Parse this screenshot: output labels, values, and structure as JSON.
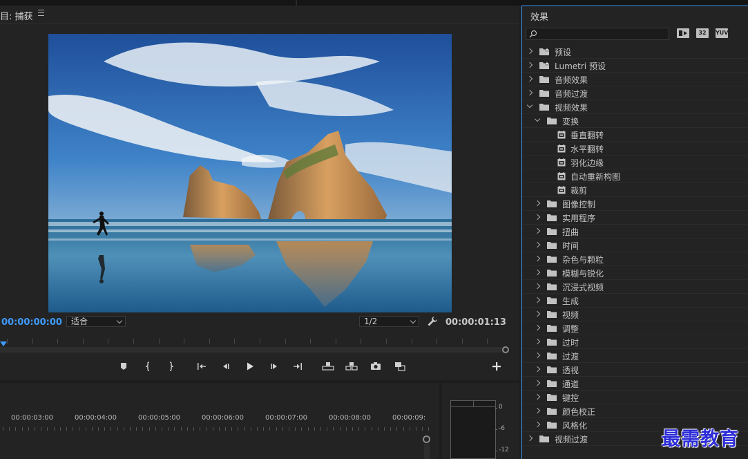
{
  "program_monitor": {
    "title": "目: 捕获",
    "timecode_current": "00:00:00:00",
    "timecode_duration": "00:00:01:13",
    "fit_select": "适合",
    "resolution_select": "1/2"
  },
  "timeline": {
    "ruler_labels": [
      "00:00:03:00",
      "00:00:04:00",
      "00:00:05:00",
      "00:00:06:00",
      "00:00:07:00",
      "00:00:08:00",
      "00:00:09:"
    ]
  },
  "audio_meter": {
    "scale": [
      "0",
      "-6",
      "-12"
    ]
  },
  "effects_panel": {
    "title": "效果",
    "search_placeholder": "",
    "badges": [
      "",
      "32",
      "YUV"
    ],
    "items": [
      {
        "label": "预设",
        "level": 0,
        "expanded": false,
        "type": "preset-folder"
      },
      {
        "label": "Lumetri 预设",
        "level": 0,
        "expanded": false,
        "type": "preset-folder"
      },
      {
        "label": "音频效果",
        "level": 0,
        "expanded": false,
        "type": "folder"
      },
      {
        "label": "音频过渡",
        "level": 0,
        "expanded": false,
        "type": "folder"
      },
      {
        "label": "视频效果",
        "level": 0,
        "expanded": true,
        "type": "folder"
      },
      {
        "label": "变换",
        "level": 1,
        "expanded": true,
        "type": "folder"
      },
      {
        "label": "垂直翻转",
        "level": 2,
        "type": "effect"
      },
      {
        "label": "水平翻转",
        "level": 2,
        "type": "effect"
      },
      {
        "label": "羽化边缘",
        "level": 2,
        "type": "effect"
      },
      {
        "label": "自动重新构图",
        "level": 2,
        "type": "effect"
      },
      {
        "label": "裁剪",
        "level": 2,
        "type": "effect"
      },
      {
        "label": "图像控制",
        "level": 1,
        "expanded": false,
        "type": "folder"
      },
      {
        "label": "实用程序",
        "level": 1,
        "expanded": false,
        "type": "folder"
      },
      {
        "label": "扭曲",
        "level": 1,
        "expanded": false,
        "type": "folder"
      },
      {
        "label": "时间",
        "level": 1,
        "expanded": false,
        "type": "folder"
      },
      {
        "label": "杂色与颗粒",
        "level": 1,
        "expanded": false,
        "type": "folder"
      },
      {
        "label": "模糊与锐化",
        "level": 1,
        "expanded": false,
        "type": "folder"
      },
      {
        "label": "沉浸式视频",
        "level": 1,
        "expanded": false,
        "type": "folder"
      },
      {
        "label": "生成",
        "level": 1,
        "expanded": false,
        "type": "folder"
      },
      {
        "label": "视频",
        "level": 1,
        "expanded": false,
        "type": "folder"
      },
      {
        "label": "调整",
        "level": 1,
        "expanded": false,
        "type": "folder"
      },
      {
        "label": "过时",
        "level": 1,
        "expanded": false,
        "type": "folder"
      },
      {
        "label": "过渡",
        "level": 1,
        "expanded": false,
        "type": "folder"
      },
      {
        "label": "透视",
        "level": 1,
        "expanded": false,
        "type": "folder"
      },
      {
        "label": "通道",
        "level": 1,
        "expanded": false,
        "type": "folder"
      },
      {
        "label": "键控",
        "level": 1,
        "expanded": false,
        "type": "folder"
      },
      {
        "label": "颜色校正",
        "level": 1,
        "expanded": false,
        "type": "folder"
      },
      {
        "label": "风格化",
        "level": 1,
        "expanded": false,
        "type": "folder"
      },
      {
        "label": "视频过渡",
        "level": 0,
        "expanded": false,
        "type": "folder"
      }
    ]
  },
  "watermark": "最需教育",
  "colors": {
    "accent": "#3e9bff",
    "panel_bg": "#232323",
    "app_bg": "#1d1d1d",
    "watermark": "#2d2dd8"
  }
}
